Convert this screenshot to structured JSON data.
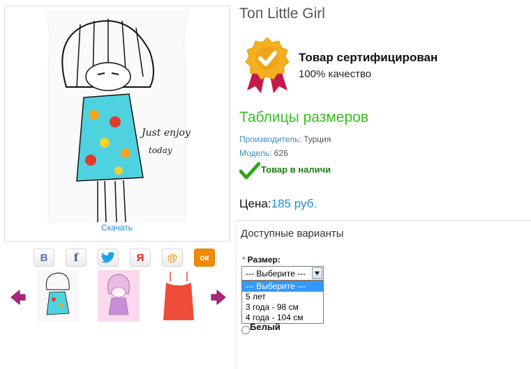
{
  "product": {
    "title": "Топ Little Girl",
    "download_label": "Скачать",
    "print_text": [
      "Just enjoy",
      "today"
    ]
  },
  "share": [
    {
      "icon": "vk-icon",
      "glyph": "В",
      "color": "#4a76a8"
    },
    {
      "icon": "facebook-icon",
      "glyph": "f",
      "color": "#3b5998"
    },
    {
      "icon": "twitter-icon",
      "glyph": "",
      "color": "#1da1f2"
    },
    {
      "icon": "yandex-icon",
      "glyph": "Я",
      "color": "#e0201c"
    },
    {
      "icon": "mailru-icon",
      "glyph": "@",
      "color": "#f39c12"
    },
    {
      "icon": "odnoklassniki-icon",
      "glyph": "ок",
      "color": "#f28a00"
    }
  ],
  "certificate": {
    "title": "Товар сертифицирован",
    "subtitle": "100% качество"
  },
  "size_table_link": "Таблицы размеров",
  "manufacturer": {
    "label": "Производитель:",
    "value": "Турция"
  },
  "model": {
    "label": "Модель:",
    "value": "626"
  },
  "stock_status": "Товар в наличи",
  "price": {
    "label": "Цена:",
    "value": "185 руб."
  },
  "variants": {
    "heading": "Доступные варианты",
    "size_label": "Размер:",
    "required_mark": "*",
    "selected": "--- Выберите ---",
    "options": [
      "--- Выберите ---",
      "5 лет",
      "3 года - 98 см",
      "4 года - 104 см"
    ],
    "color_option": "Белый"
  },
  "colors": {
    "accent_green": "#3bbd23",
    "link_blue": "#1a8fc9",
    "stock_green": "#1f7d12"
  }
}
